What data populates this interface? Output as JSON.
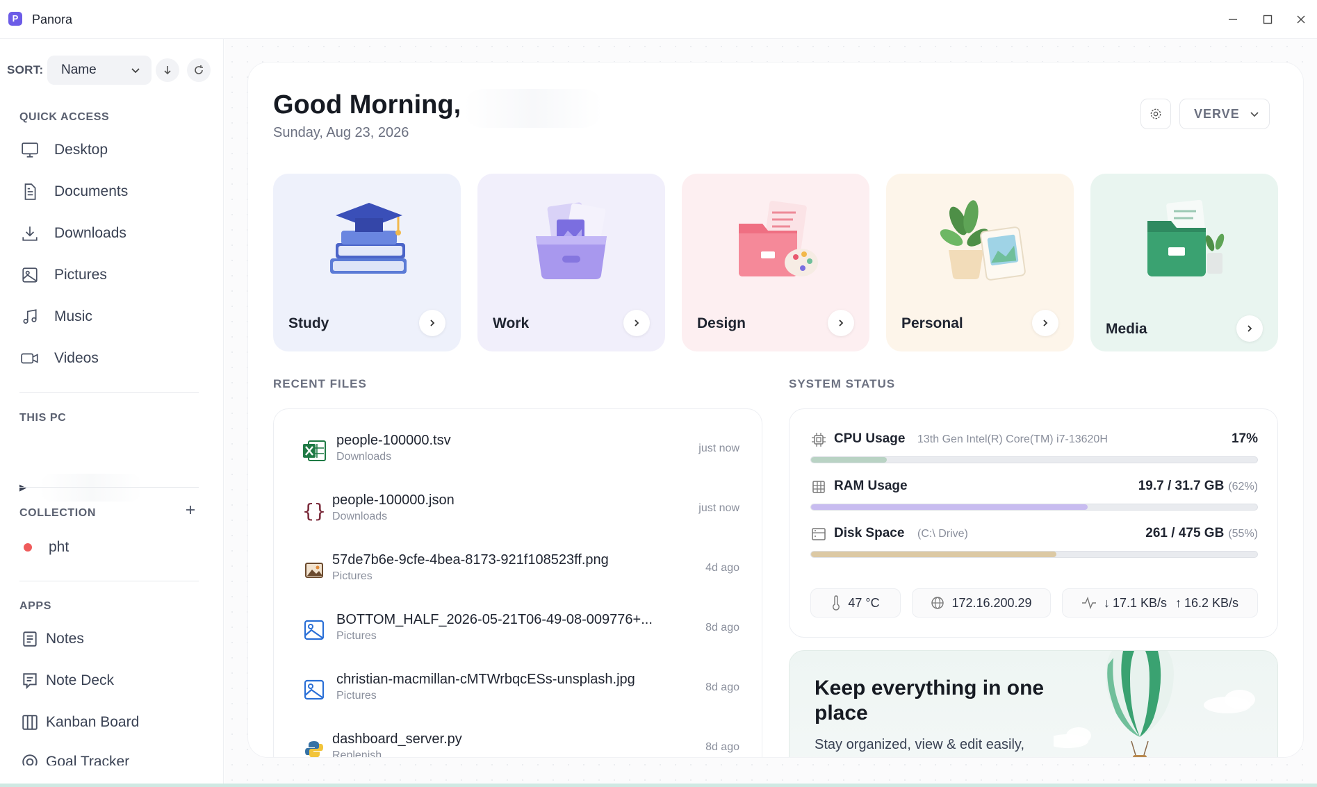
{
  "app": {
    "title": "Panora",
    "logo_letter": "P"
  },
  "sidebar": {
    "sort_label": "SORT:",
    "sort_value": "Name",
    "quick_access_title": "QUICK ACCESS",
    "quick_access": [
      {
        "label": "Desktop",
        "icon": "desktop-icon"
      },
      {
        "label": "Documents",
        "icon": "document-icon"
      },
      {
        "label": "Downloads",
        "icon": "download-icon"
      },
      {
        "label": "Pictures",
        "icon": "image-icon"
      },
      {
        "label": "Music",
        "icon": "music-icon"
      },
      {
        "label": "Videos",
        "icon": "video-icon"
      }
    ],
    "this_pc_title": "THIS PC",
    "collection_title": "COLLECTION",
    "collections": [
      {
        "label": "pht",
        "color": "#ef5b5b"
      }
    ],
    "apps_title": "APPS",
    "apps": [
      {
        "label": "Notes",
        "icon": "notes-icon"
      },
      {
        "label": "Note Deck",
        "icon": "note-deck-icon"
      },
      {
        "label": "Kanban Board",
        "icon": "kanban-icon"
      },
      {
        "label": "Goal Tracker",
        "icon": "goal-icon"
      }
    ]
  },
  "header": {
    "greeting": "Good Morning,",
    "date": "Sunday, Aug 23, 2026",
    "theme": "VERVE"
  },
  "categories": [
    {
      "label": "Study",
      "bg": "#eef1fb"
    },
    {
      "label": "Work",
      "bg": "#f1effb"
    },
    {
      "label": "Design",
      "bg": "#fdeff1"
    },
    {
      "label": "Personal",
      "bg": "#fdf5ea"
    },
    {
      "label": "Media",
      "bg": "#e9f5f0"
    }
  ],
  "recent_files": {
    "title": "RECENT FILES",
    "items": [
      {
        "name": "people-100000.tsv",
        "location": "Downloads",
        "time": "just now",
        "icon": "excel-icon"
      },
      {
        "name": "people-100000.json",
        "location": "Downloads",
        "time": "just now",
        "icon": "json-icon"
      },
      {
        "name": "57de7b6e-9cfe-4bea-8173-921f108523ff.png",
        "location": "Pictures",
        "time": "4d ago",
        "icon": "png-icon"
      },
      {
        "name": "BOTTOM_HALF_2026-05-21T06-49-08-009776+...",
        "location": "Pictures",
        "time": "8d ago",
        "icon": "image-file-icon"
      },
      {
        "name": "christian-macmillan-cMTWrbqcESs-unsplash.jpg",
        "location": "Pictures",
        "time": "8d ago",
        "icon": "image-file-icon"
      },
      {
        "name": "dashboard_server.py",
        "location": "Replenish",
        "time": "8d ago",
        "icon": "python-icon"
      }
    ]
  },
  "system_status": {
    "title": "SYSTEM STATUS",
    "cpu": {
      "label": "CPU Usage",
      "desc": "13th Gen Intel(R) Core(TM) i7-13620H",
      "value": "17%",
      "fraction": 0.17,
      "color": "#b9d3c4"
    },
    "ram": {
      "label": "RAM Usage",
      "value": "19.7 / 31.7 GB",
      "pct": "(62%)",
      "fraction": 0.62,
      "color": "#c8bcf0"
    },
    "disk": {
      "label": "Disk Space",
      "desc": "(C:\\ Drive)",
      "value": "261 / 475 GB",
      "pct": "(55%)",
      "fraction": 0.55,
      "color": "#dcc9a4"
    },
    "temperature": "47 °C",
    "ip": "172.16.200.29",
    "net_down": "17.1 KB/s",
    "net_up": "16.2 KB/s"
  },
  "promo": {
    "title": "Keep everything in one place",
    "subtitle": "Stay organized, view & edit easily,"
  }
}
